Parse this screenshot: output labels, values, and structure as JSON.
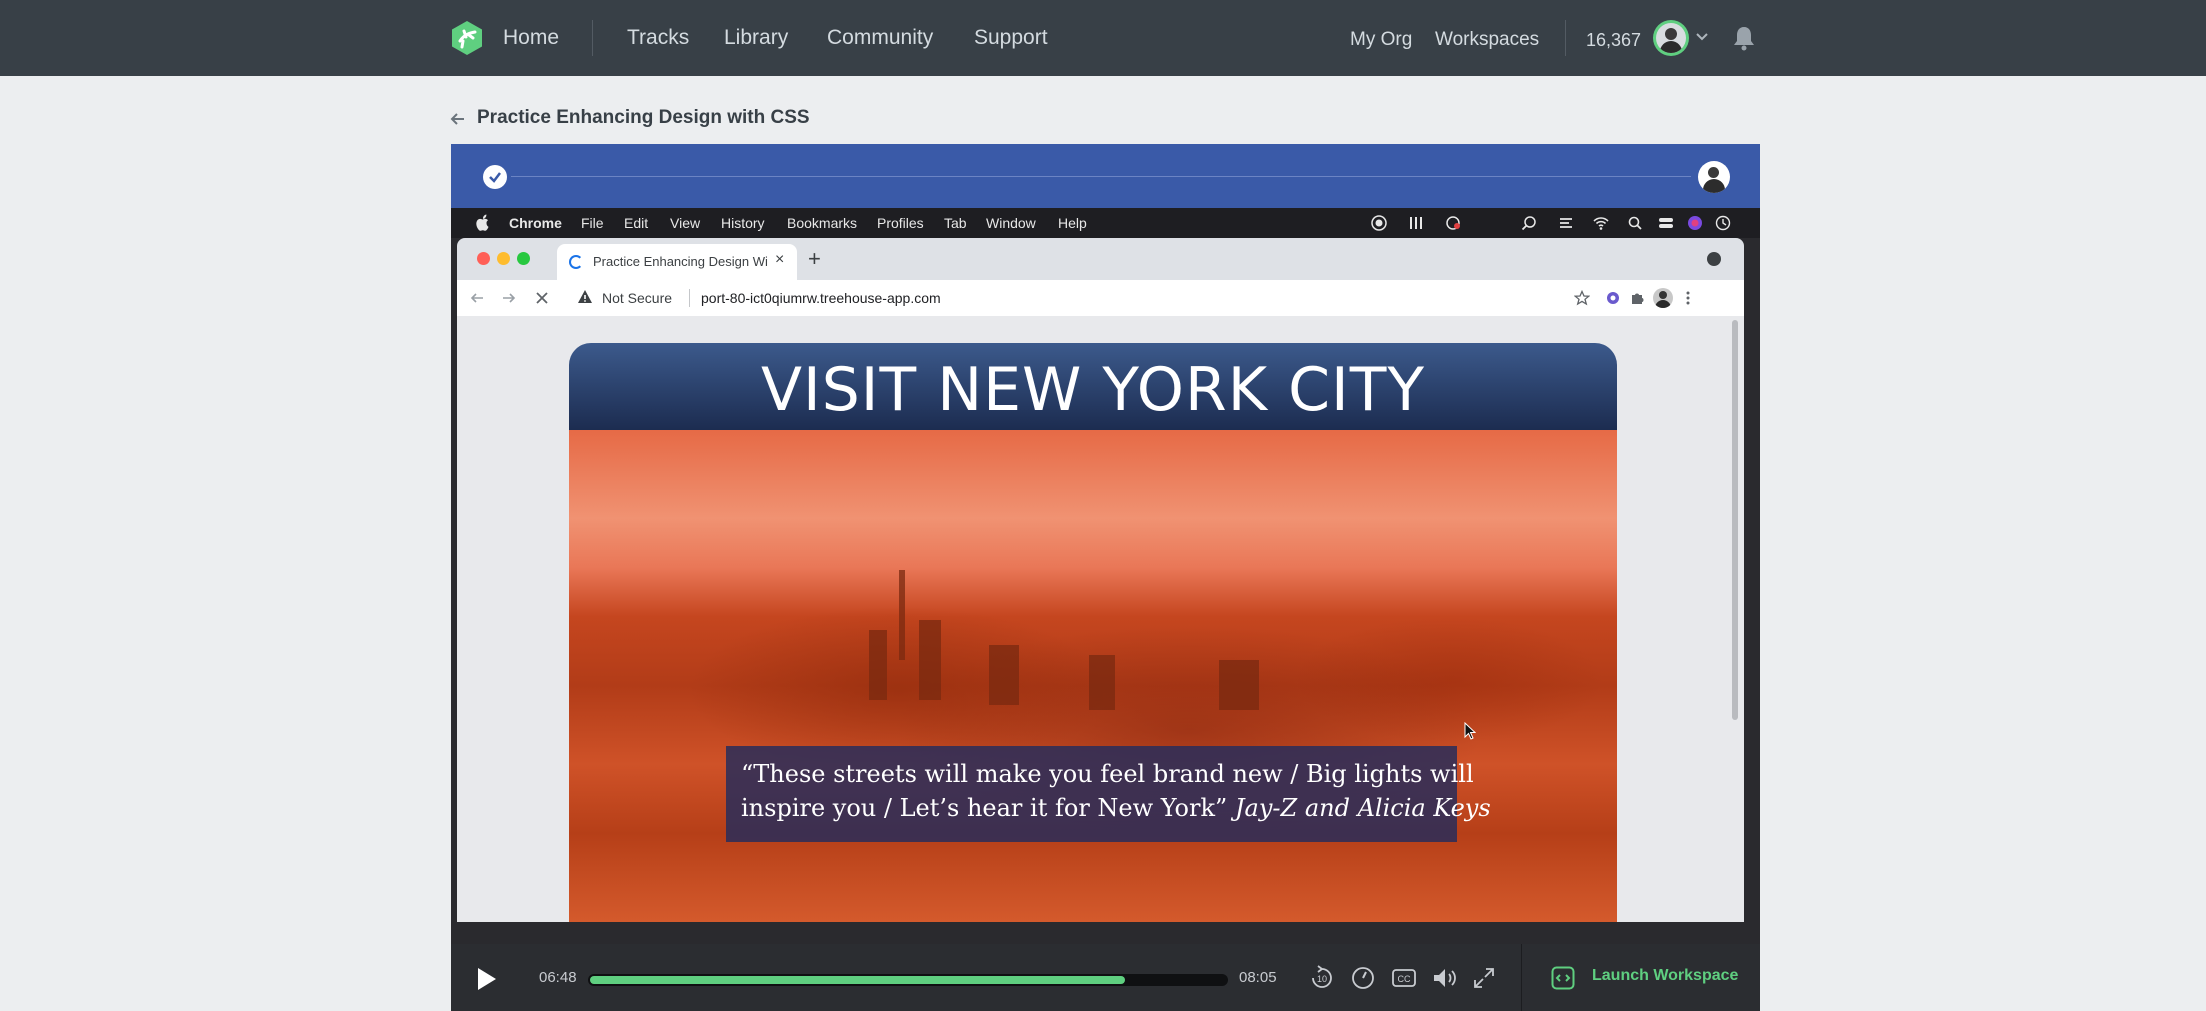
{
  "nav": {
    "home": "Home",
    "tracks": "Tracks",
    "library": "Library",
    "community": "Community",
    "support": "Support",
    "my_org": "My Org",
    "workspaces": "Workspaces",
    "points": "16,367"
  },
  "breadcrumb": {
    "title": "Practice Enhancing Design with CSS"
  },
  "mac_menu": {
    "app": "Chrome",
    "items": [
      "File",
      "Edit",
      "View",
      "History",
      "Bookmarks",
      "Profiles",
      "Tab",
      "Window",
      "Help"
    ]
  },
  "browser": {
    "tab_title": "Practice Enhancing Design Wi",
    "new_tab": "+",
    "close_tab": "×",
    "security": "Not Secure",
    "url": "port-80-ict0qiumrw.treehouse-app.com"
  },
  "page": {
    "heading": "VISIT NEW YORK CITY",
    "quote_line1": "“These streets will make you feel brand new / Big lights will",
    "quote_line2": "inspire you / Let’s hear it for New York”",
    "quote_author": "Jay-Z and Alicia Keys"
  },
  "player": {
    "current_time": "06:48",
    "duration": "08:05",
    "progress_fraction": 0.841,
    "launch_label": "Launch Workspace"
  },
  "colors": {
    "brand_green": "#5fcf80",
    "nav_bg": "#384047",
    "strip_blue": "#3a5aa8"
  }
}
